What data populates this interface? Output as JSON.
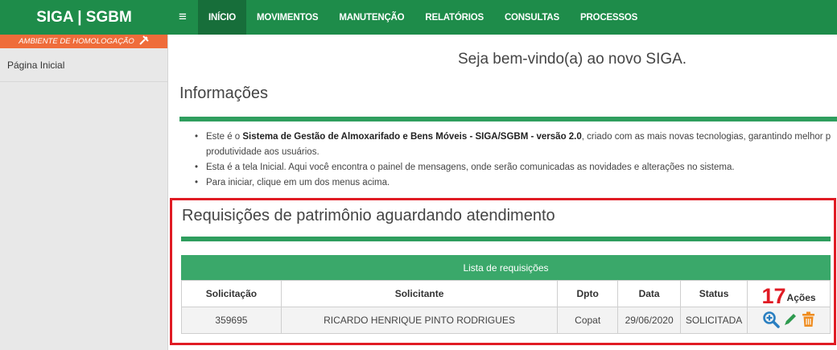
{
  "app": {
    "brand": "SIGA | SGBM",
    "env_label": "AMBIENTE DE HOMOLOGAÇÃO"
  },
  "nav": {
    "menu_icon": "hamburger-icon",
    "items": [
      "INÍCIO",
      "MOVIMENTOS",
      "MANUTENÇÃO",
      "RELATÓRIOS",
      "CONSULTAS",
      "PROCESSOS"
    ],
    "active": "INÍCIO"
  },
  "sidebar": {
    "items": [
      "Página Inicial"
    ]
  },
  "main": {
    "welcome": "Seja bem-vindo(a) ao novo SIGA.",
    "info_title": "Informações",
    "info": {
      "b1_pre": "Este é o ",
      "b1_bold": "Sistema de Gestão de Almoxarifado e Bens Móveis - SIGA/SGBM - versão 2.0",
      "b1_post": ", criado com as mais novas tecnologias, garantindo melhor p",
      "b1_cont": "produtividade aos usuários.",
      "b2": "Esta é a tela Inicial. Aqui você encontra o painel de mensagens, onde serão comunicadas as novidades e alterações no sistema.",
      "b3": "Para iniciar, clique em um dos menus acima."
    },
    "requests": {
      "title": "Requisições de patrimônio aguardando atendimento",
      "caption": "Lista de requisições",
      "headers": [
        "Solicitação",
        "Solicitante",
        "Dpto",
        "Data",
        "Status",
        "Ações"
      ],
      "annotation": "17",
      "rows": [
        {
          "solicitacao": "359695",
          "solicitante": "RICARDO HENRIQUE PINTO RODRIGUES",
          "dpto": "Copat",
          "data": "29/06/2020",
          "status": "SOLICITADA"
        }
      ],
      "actions": [
        "zoom-in-icon",
        "pencil-edit-icon",
        "trash-icon"
      ]
    }
  },
  "colors": {
    "topbar": "#1e8c4a",
    "active_nav": "#176e3a",
    "env": "#ef6c3a",
    "caption": "#3aa86a",
    "highlight": "#e01b24"
  }
}
